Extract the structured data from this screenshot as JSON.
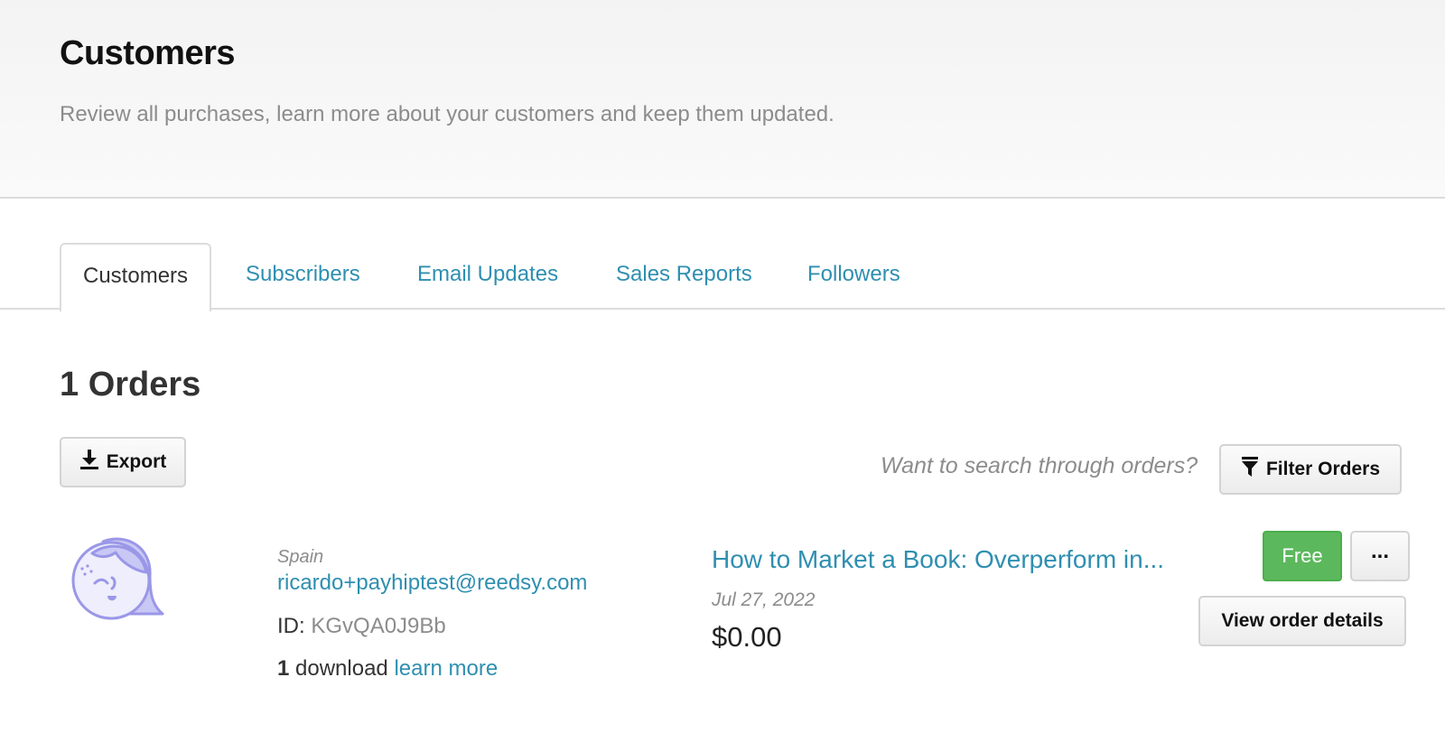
{
  "header": {
    "title": "Customers",
    "subtitle": "Review all purchases, learn more about your customers and keep them updated."
  },
  "tabs": [
    {
      "label": "Customers",
      "active": true
    },
    {
      "label": "Subscribers",
      "active": false
    },
    {
      "label": "Email Updates",
      "active": false
    },
    {
      "label": "Sales Reports",
      "active": false
    },
    {
      "label": "Followers",
      "active": false
    }
  ],
  "orders": {
    "count_label": "1 Orders",
    "export_label": "Export",
    "search_hint": "Want to search through orders?",
    "filter_label": "Filter Orders"
  },
  "order": {
    "country": "Spain",
    "email": "ricardo+payhiptest@reedsy.com",
    "id_label": "ID:",
    "id_value": "KGvQA0J9Bb",
    "download_count": "1",
    "download_label": "download",
    "learn_more": "learn more",
    "product": "How to Market a Book: Overperform in...",
    "date": "Jul 27, 2022",
    "price": "$0.00",
    "status": "Free",
    "more_label": "...",
    "view_details_label": "View order details"
  },
  "colors": {
    "link": "#2f8fb0",
    "free_badge": "#5cb85c",
    "avatar": "#9a97e8"
  },
  "icons": {
    "export": "download-icon",
    "filter": "filter-icon",
    "avatar": "customer-avatar-icon"
  }
}
